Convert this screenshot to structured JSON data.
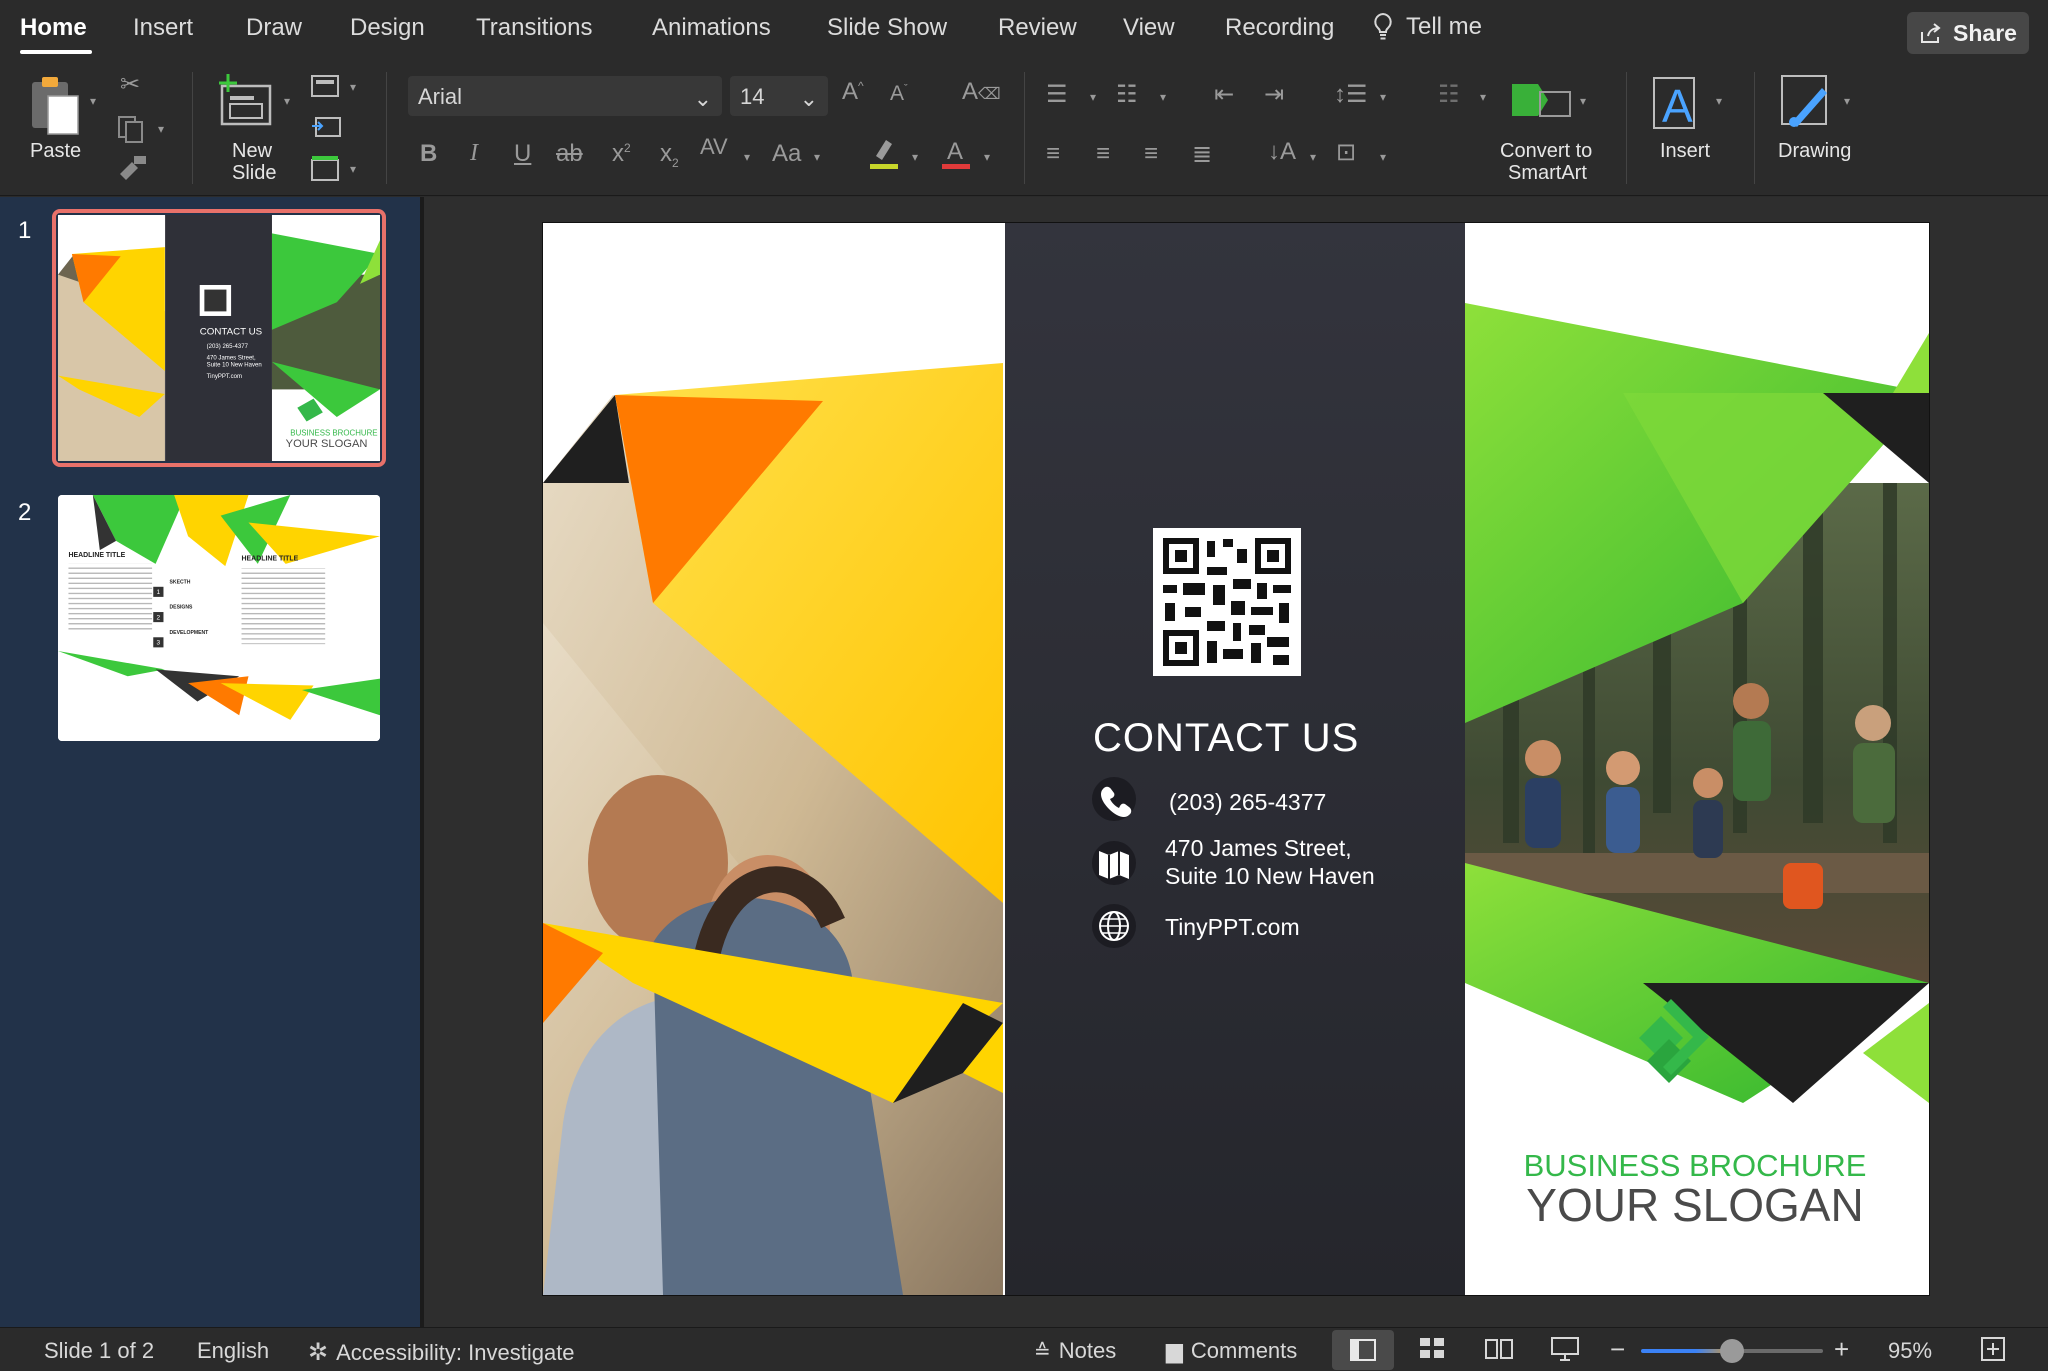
{
  "tabs": [
    {
      "label": "Home",
      "active": true
    },
    {
      "label": "Insert"
    },
    {
      "label": "Draw"
    },
    {
      "label": "Design"
    },
    {
      "label": "Transitions"
    },
    {
      "label": "Animations"
    },
    {
      "label": "Slide Show"
    },
    {
      "label": "Review"
    },
    {
      "label": "View"
    },
    {
      "label": "Recording"
    }
  ],
  "tell_me": "Tell me",
  "share_label": "Share",
  "ribbon": {
    "paste": "Paste",
    "new_slide_line1": "New",
    "new_slide_line2": "Slide",
    "font_name": "Arial",
    "font_size": "14",
    "convert_line1": "Convert to",
    "convert_line2": "SmartArt",
    "insert": "Insert",
    "drawing": "Drawing",
    "accent_highlight": "#c7d62a",
    "accent_font_color": "#e03a3a"
  },
  "thumbnails": [
    {
      "number": "1",
      "selected": true
    },
    {
      "number": "2",
      "selected": false
    }
  ],
  "thumb1_text": {
    "contact": "CONTACT US",
    "phone": "(203) 265-4377",
    "addr1": "470 James Street,",
    "addr2": "Suite 10 New Haven",
    "web": "TinyPPT.com",
    "brochure": "BUSINESS BROCHURE",
    "slogan": "YOUR SLOGAN"
  },
  "thumb2_text": {
    "headline_left": "HEADLINE TITLE",
    "headline_right": "HEADLINE TITLE",
    "item1_num": "1",
    "item1": "SKECTH",
    "item2_num": "2",
    "item2": "DESIGNS",
    "item3_num": "3",
    "item3": "DEVELOPMENT"
  },
  "slide": {
    "contact_title": "CONTACT US",
    "phone": "(203) 265-4377",
    "address_line1": "470 James Street,",
    "address_line2": "Suite 10 New Haven",
    "website": "TinyPPT.com",
    "brochure_title": "BUSINESS BROCHURE",
    "slogan": "YOUR SLOGAN",
    "colors": {
      "dark_panel": "#2f3038",
      "yellow": "#ffd400",
      "orange": "#ff7a00",
      "green": "#3cc83c",
      "lime": "#8ee03a",
      "brand_green": "#34b84a",
      "slogan_gray": "#4a4a4a"
    }
  },
  "status": {
    "slide_indicator": "Slide 1 of 2",
    "language": "English",
    "accessibility": "Accessibility: Investigate",
    "notes": "Notes",
    "comments": "Comments",
    "zoom": "95%",
    "zoom_level": 0.5
  }
}
